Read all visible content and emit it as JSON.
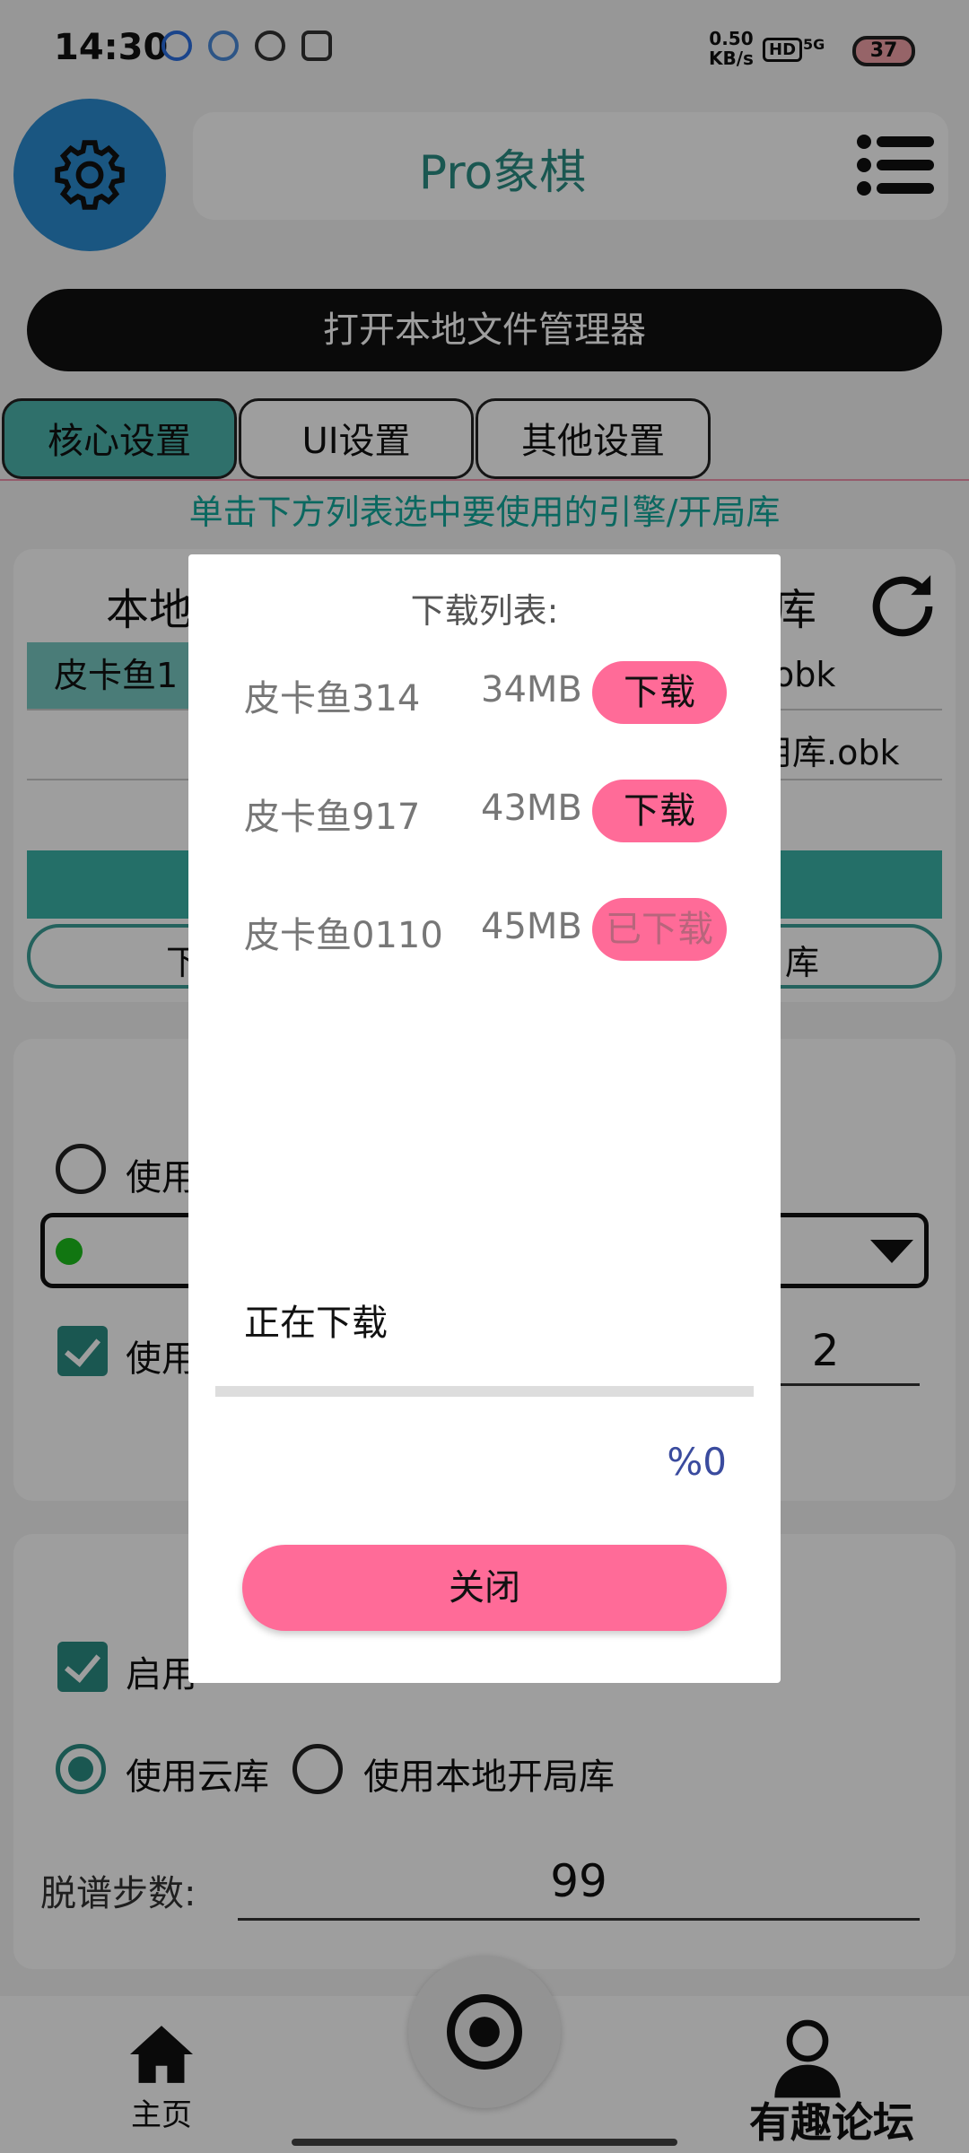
{
  "status_bar": {
    "time": "14:30",
    "net_speed_value": "0.50",
    "net_speed_unit": "KB/s",
    "hd_label": "HD",
    "signal_label": "5G",
    "battery": "37"
  },
  "app": {
    "title": "Pro象棋",
    "open_file_manager": "打开本地文件管理器",
    "tabs": [
      "核心设置",
      "UI设置",
      "其他设置"
    ],
    "hint": "单击下方列表选中要使用的引擎/开局库"
  },
  "card1": {
    "title_left": "本地",
    "title_right": "库",
    "selected_item": "皮卡鱼1",
    "item1_right": "obk",
    "item2_right": "用库.obk",
    "pill_left": "下",
    "pill_right": "库"
  },
  "card2": {
    "radio_label": "使用",
    "checkbox_label": "使用",
    "number_value": "2"
  },
  "card3": {
    "checkbox_label": "启用",
    "radio_cloud": "使用云库",
    "radio_local": "使用本地开局库",
    "steps_label": "脱谱步数:",
    "steps_value": "99"
  },
  "bottom_nav": {
    "home_label": "主页",
    "watermark": "有趣论坛"
  },
  "dialog": {
    "title": "下载列表:",
    "items": [
      {
        "name": "皮卡鱼314",
        "size": "34MB",
        "button": "下载"
      },
      {
        "name": "皮卡鱼917",
        "size": "43MB",
        "button": "下载"
      },
      {
        "name": "皮卡鱼0110",
        "size": "45MB",
        "button": "已下载"
      }
    ],
    "status": "正在下载",
    "progress": 0,
    "percent_text": "%0",
    "close_label": "关闭"
  },
  "colors": {
    "accent_teal": "#2a8d84",
    "accent_pink": "#ff6b98",
    "gear_blue": "#2a8bd0"
  }
}
